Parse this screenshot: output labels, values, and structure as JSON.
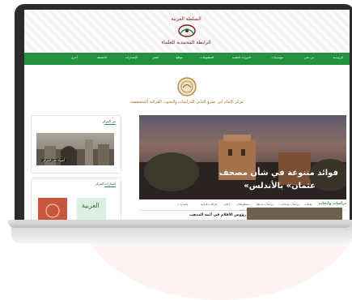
{
  "header": {
    "org_name": "السلطة العربية",
    "site_name": "الرابطة المحمدية للعلماء"
  },
  "nav": {
    "items": [
      "الرئيسية",
      "من نحن",
      "مؤسسات",
      "الدورات العلمية",
      "المطبوعات",
      "مواقع",
      "اتصل",
      "الإصدارات",
      "الأنشطة",
      "آخرى"
    ]
  },
  "center": {
    "name": "مركز الإمام أبي عمرو الداني للدراسات والبحوث القرائية المتخصصة"
  },
  "slider": {
    "title_line1": "فوائد متنوعة في شأن مصحف",
    "title_line2": "«عثمان» بالأندلس"
  },
  "tabs": {
    "active": "دراسات وأبحاث",
    "items": [
      "مقالات",
      "دراسات وأبحاث",
      "دراسات سابقة",
      "مخطوطات",
      "أعلام",
      "قراءات قرآنية",
      "إصدارات"
    ]
  },
  "article": {
    "meta": "د. أحمد",
    "title": "رؤوس الأقلام في أئمة المذهب"
  },
  "sidebar": {
    "box1_title": "من المركز",
    "box1_caption": "أضواء على المركز",
    "box2_title": "إصدارات المركز",
    "book_title": "العربية"
  },
  "colors": {
    "nav_green": "#23913f",
    "accent_brown": "#a36a1b",
    "header_red": "#7a1d1d"
  }
}
